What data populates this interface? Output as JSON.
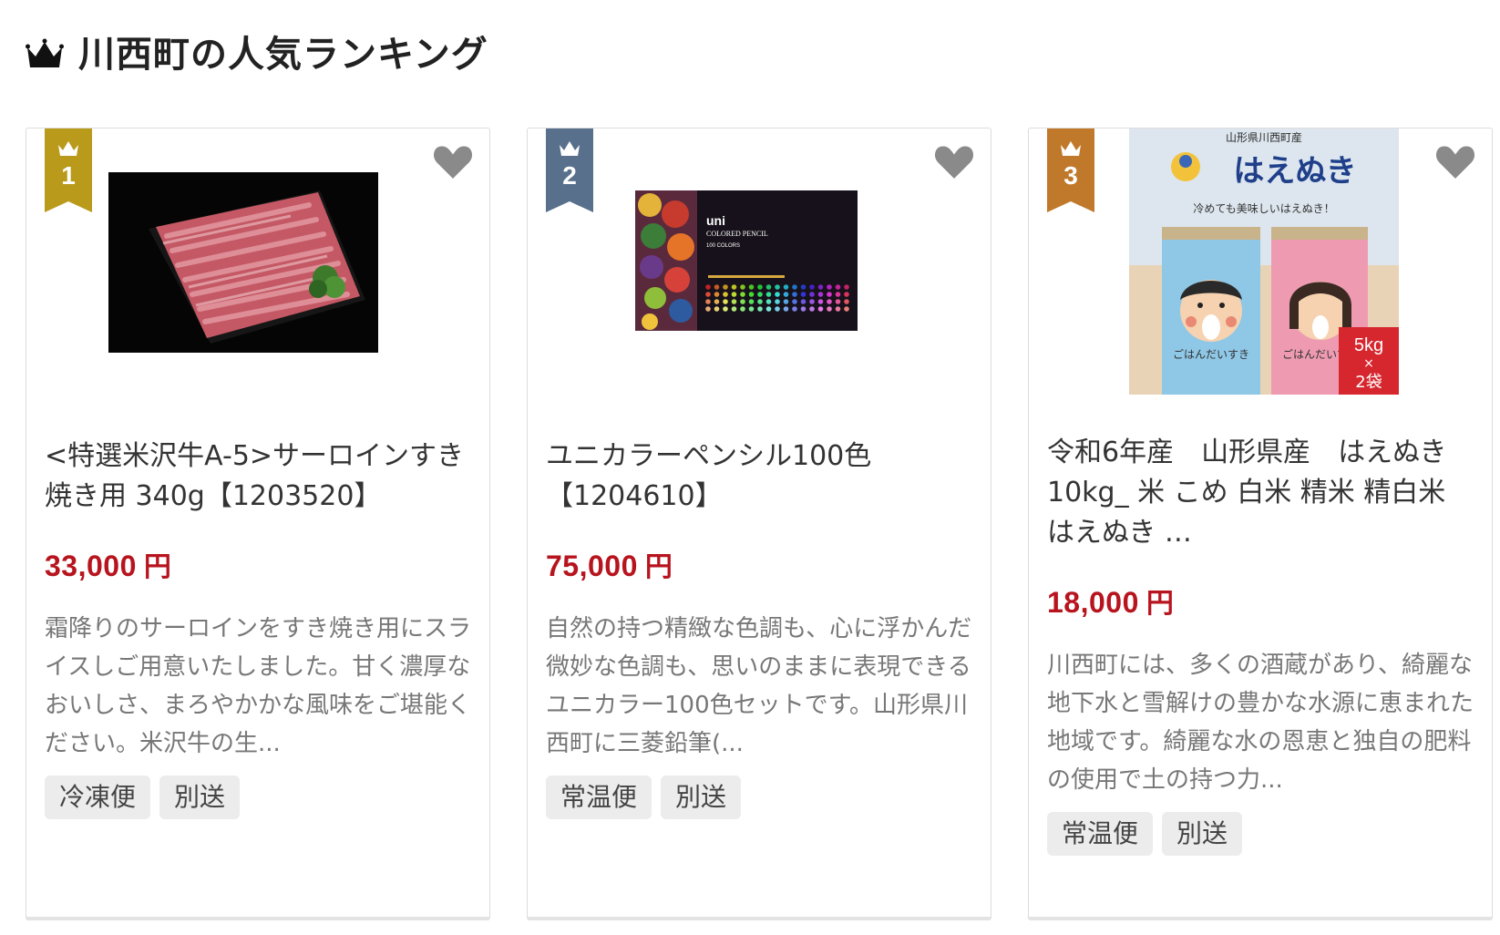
{
  "section": {
    "title": "川西町の人気ランキング"
  },
  "colors": {
    "gold": "#b99a1b",
    "silver": "#58708b",
    "bronze": "#c0792b",
    "price": "#b7141e",
    "heart": "#8a8a8a"
  },
  "products": [
    {
      "rank": "1",
      "title": "<特選米沢牛A-5>サーロインすき焼き用 340g【1203520】",
      "price": "33,000",
      "price_unit": "円",
      "description": "霜降りのサーロインをすき焼き用にスライスしご用意いたしました。甘く濃厚なおいしさ、まろやかかな風味をご堪能ください。米沢牛の生...",
      "tags": [
        "冷凍便",
        "別送"
      ],
      "favorite_icon": "heart-icon"
    },
    {
      "rank": "2",
      "title": "ユニカラーペンシル100色【1204610】",
      "price": "75,000",
      "price_unit": "円",
      "description": "自然の持つ精緻な色調も、心に浮かんだ微妙な色調も、思いのままに表現できるユニカラー100色セットです。山形県川西町に三菱鉛筆(...",
      "tags": [
        "常温便",
        "別送"
      ],
      "image_text": {
        "brand": "uni",
        "line": "COLORED PENCIL",
        "sub": "100 COLORS"
      },
      "favorite_icon": "heart-icon"
    },
    {
      "rank": "3",
      "title": "令和6年産　山形県産　はえぬき10kg_ 米 こめ 白米 精米 精白米 はえぬき …",
      "price": "18,000",
      "price_unit": "円",
      "description": "川西町には、多くの酒蔵があり、綺麗な地下水と雪解けの豊かな水源に恵まれた地域です。綺麗な水の恩恵と独自の肥料の使用で土の持つ力...",
      "tags": [
        "常温便",
        "別送"
      ],
      "image_text": {
        "origin": "山形県川西町産",
        "brand": "はえぬき",
        "tagline": "冷めても美味しいはえぬき！",
        "bag_label": "ごはんだいすき",
        "weight": "5kg",
        "times": "×",
        "count": "2袋"
      },
      "favorite_icon": "heart-icon"
    }
  ]
}
